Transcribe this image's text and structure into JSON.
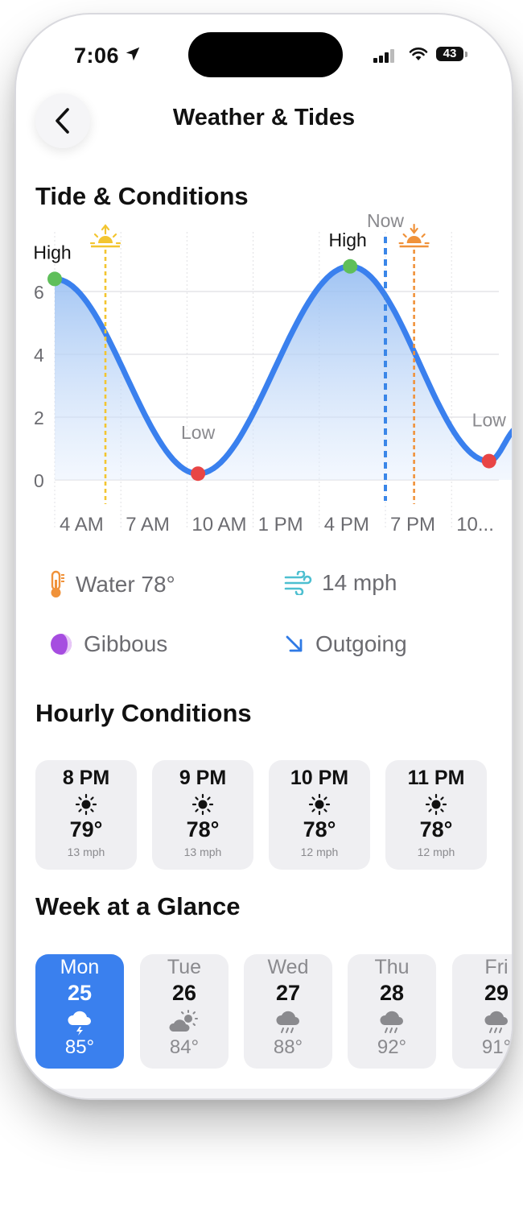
{
  "status": {
    "time": "7:06",
    "battery": "43"
  },
  "nav": {
    "title": "Weather & Tides"
  },
  "tide_section": {
    "title": "Tide & Conditions"
  },
  "chart_data": {
    "type": "area",
    "x_ticks": [
      "4 AM",
      "7 AM",
      "10 AM",
      "1 PM",
      "4 PM",
      "7 PM",
      "10..."
    ],
    "y_ticks": [
      0,
      2,
      4,
      6
    ],
    "ylim": [
      0,
      7
    ],
    "series": [
      {
        "points": [
          [
            3.1,
            6.4
          ],
          [
            9.6,
            0.2
          ],
          [
            16.5,
            6.8
          ],
          [
            22.8,
            0.6
          ],
          [
            24.2,
            1.7
          ]
        ]
      }
    ],
    "extremes": [
      {
        "label": "High",
        "x": 3.1,
        "y": 6.4,
        "color": "#5fbf5a"
      },
      {
        "label": "Low",
        "x": 9.6,
        "y": 0.2,
        "color": "#e84545"
      },
      {
        "label": "High",
        "x": 16.5,
        "y": 6.8,
        "color": "#5fbf5a"
      },
      {
        "label": "Low",
        "x": 22.8,
        "y": 0.6,
        "color": "#e84545"
      }
    ],
    "markers": {
      "now": {
        "label": "Now",
        "x": 18.1,
        "color": "#3a86e8"
      },
      "sunrise": {
        "x": 5.4,
        "color": "#f3c530"
      },
      "sunset": {
        "x": 19.4,
        "color": "#f0923a"
      }
    },
    "grid": true,
    "line_color": "#3a80ee"
  },
  "conditions": {
    "water": "Water 78°",
    "wind": "14 mph",
    "moon": "Gibbous",
    "tide_dir": "Outgoing"
  },
  "hourly": {
    "title": "Hourly Conditions",
    "items": [
      {
        "time": "8 PM",
        "temp": "79°",
        "wind": "13 mph",
        "icon": "sun-icon"
      },
      {
        "time": "9 PM",
        "temp": "78°",
        "wind": "13 mph",
        "icon": "sun-icon"
      },
      {
        "time": "10 PM",
        "temp": "78°",
        "wind": "12 mph",
        "icon": "sun-icon"
      },
      {
        "time": "11 PM",
        "temp": "78°",
        "wind": "12 mph",
        "icon": "sun-icon"
      }
    ]
  },
  "week": {
    "title": "Week at a Glance",
    "items": [
      {
        "day": "Mon",
        "date": "25",
        "temp": "85°",
        "icon": "thunderstorm-icon"
      },
      {
        "day": "Tue",
        "date": "26",
        "temp": "84°",
        "icon": "partly-cloudy-icon"
      },
      {
        "day": "Wed",
        "date": "27",
        "temp": "88°",
        "icon": "rain-icon"
      },
      {
        "day": "Thu",
        "date": "28",
        "temp": "92°",
        "icon": "rain-icon"
      },
      {
        "day": "Fri",
        "date": "29",
        "temp": "91°",
        "icon": "rain-icon"
      }
    ]
  }
}
